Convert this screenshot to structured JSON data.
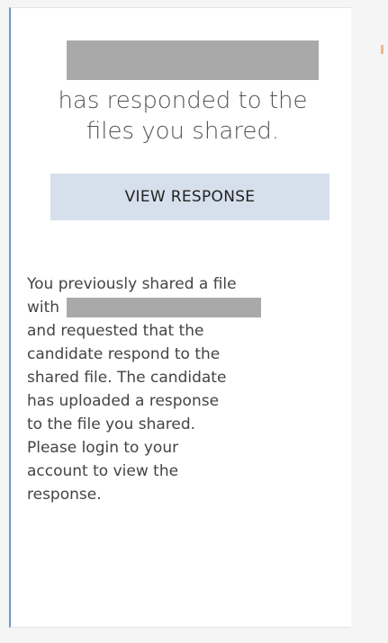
{
  "notification": {
    "headline_line1": "has responded to the",
    "headline_line2": "files you shared.",
    "button_label": "VIEW RESPONSE",
    "body_lines": [
      "You previously shared a file",
      "with",
      "and requested that the",
      "candidate respond to the",
      "shared file. The candidate",
      "has uploaded a response",
      "to the file you shared.",
      "Please login to your",
      "account to view the",
      "response."
    ]
  },
  "colors": {
    "button_bg": "#d6e0ec",
    "accent_border": "#6e96c8",
    "redaction": "#a9a9a9"
  }
}
